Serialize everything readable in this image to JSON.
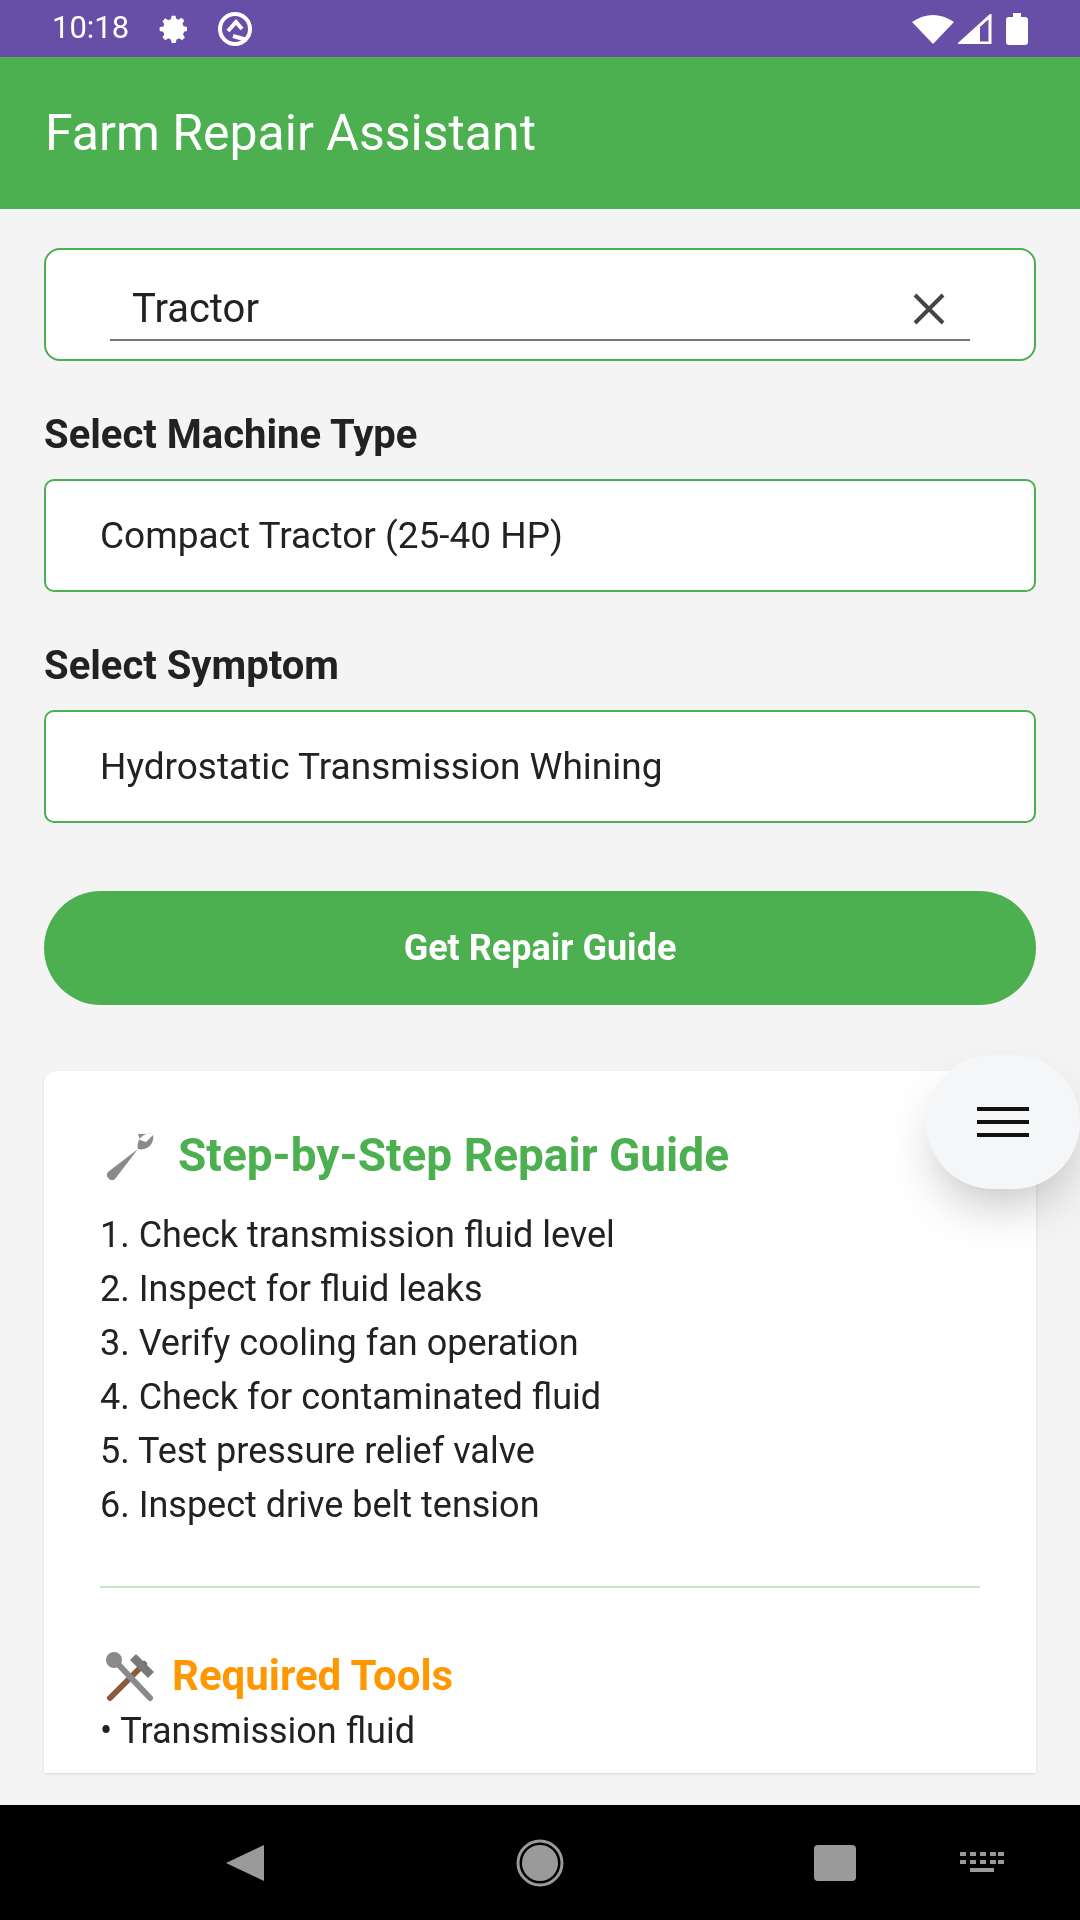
{
  "status_bar": {
    "time": "10:18"
  },
  "app_bar": {
    "title": "Farm Repair Assistant"
  },
  "search": {
    "value": "Tractor"
  },
  "machine_type": {
    "label": "Select Machine Type",
    "value": "Compact Tractor (25-40 HP)"
  },
  "symptom": {
    "label": "Select Symptom",
    "value": "Hydrostatic Transmission Whining"
  },
  "action_button": {
    "label": "Get Repair Guide"
  },
  "guide": {
    "title": "Step-by-Step Repair Guide",
    "steps": [
      "1. Check transmission fluid level",
      "2. Inspect for fluid leaks",
      "3. Verify cooling fan operation",
      "4. Check for contaminated fluid",
      "5. Test pressure relief valve",
      "6. Inspect drive belt tension"
    ]
  },
  "tools": {
    "title": "Required Tools",
    "items": [
      "• Transmission fluid"
    ]
  }
}
